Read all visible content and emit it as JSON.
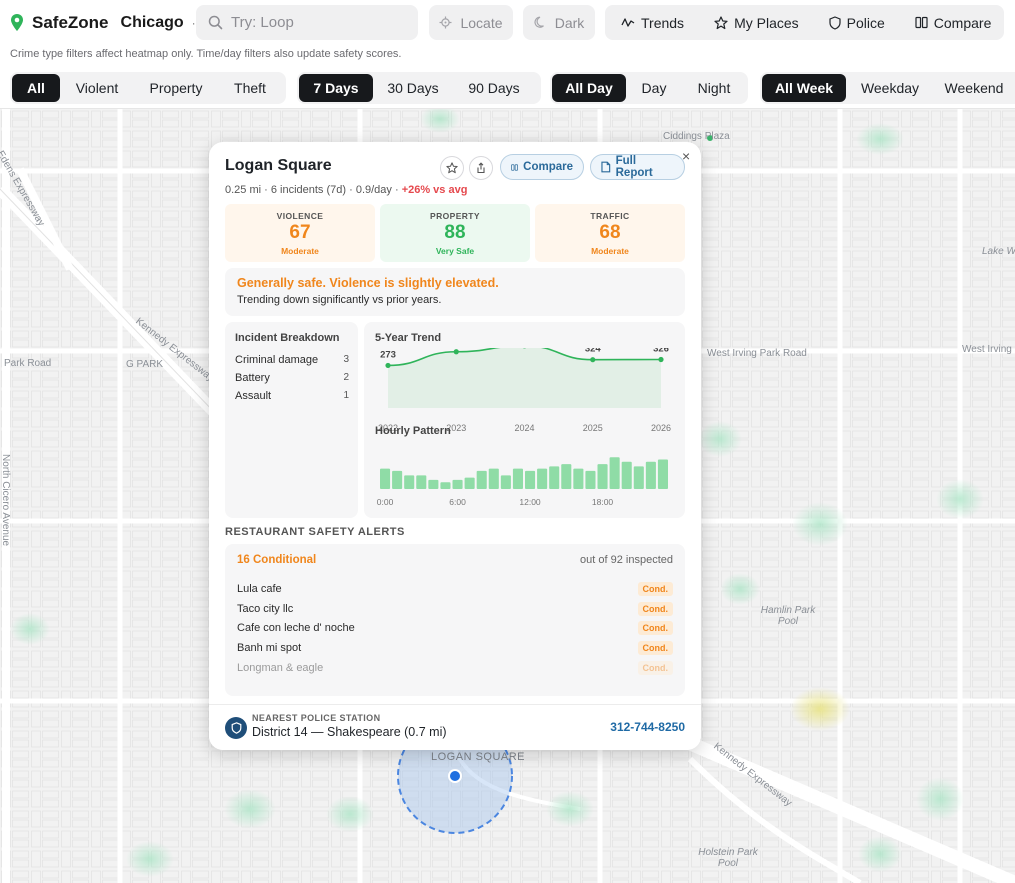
{
  "header": {
    "brand": "SafeZone",
    "city": "Chicago",
    "city_dot": "·",
    "search_placeholder": "Try: Loop",
    "locate_label": "Locate",
    "dark_label": "Dark",
    "nav": [
      {
        "label": "Trends",
        "icon": "trend-line-icon"
      },
      {
        "label": "My Places",
        "icon": "star-icon"
      },
      {
        "label": "Police",
        "icon": "shield-icon"
      },
      {
        "label": "Compare",
        "icon": "columns-icon"
      }
    ],
    "hint": "Crime type filters affect heatmap only. Time/day filters also update safety scores."
  },
  "filters": {
    "crime_types": [
      "All",
      "Violent",
      "Property",
      "Theft"
    ],
    "crime_selected": "All",
    "periods": [
      "7 Days",
      "30 Days",
      "90 Days"
    ],
    "period_selected": "7 Days",
    "times": [
      "All Day",
      "Day",
      "Night"
    ],
    "time_selected": "All Day",
    "days": [
      "All Week",
      "Weekday",
      "Weekend"
    ],
    "day_selected": "All Week"
  },
  "map": {
    "labels": [
      "Ciddings Plaza",
      "Edens Expressway",
      "Kennedy Expressway",
      "Park Road",
      "G PARK",
      "West Irving Park Road",
      "West Irving",
      "Lake W",
      "North Cicero Avenue",
      "Hamlin Park Pool",
      "Holstein Park Pool",
      "LOGAN SQUARE",
      "Kennedy Expressway"
    ]
  },
  "card": {
    "title": "Logan Square",
    "subtitle": "0.25 mi · 6 incidents (7d) · 0.9/day · ",
    "subtitle_delta": "+26% vs avg",
    "compare_label": "Compare",
    "report_label": "Full Report",
    "close_label": "×",
    "scores": [
      {
        "label": "VIOLENCE",
        "value": "67",
        "caption": "Moderate",
        "color": "#f0861c",
        "bg": "#fff6ec"
      },
      {
        "label": "PROPERTY",
        "value": "88",
        "caption": "Very Safe",
        "color": "#2fb45a",
        "bg": "#ecf9f0"
      },
      {
        "label": "TRAFFIC",
        "value": "68",
        "caption": "Moderate",
        "color": "#f0861c",
        "bg": "#fff6ec"
      }
    ],
    "summary_headline": "Generally safe. Violence is slightly elevated.",
    "summary_text": "Trending down significantly vs prior years.",
    "breakdown_title": "Incident Breakdown",
    "breakdown": [
      {
        "name": "Criminal damage",
        "count": "3"
      },
      {
        "name": "Battery",
        "count": "2"
      },
      {
        "name": "Assault",
        "count": "1"
      }
    ],
    "trend_title": "5-Year Trend",
    "hourly_title": "Hourly Pattern",
    "alerts_title": "RESTAURANT SAFETY ALERTS",
    "alerts_count": "16 Conditional",
    "alerts_inspected": "out of 92 inspected",
    "badge_label": "Cond.",
    "restaurants": [
      "Lula cafe",
      "Taco city llc",
      "Cafe con leche d' noche",
      "Banh mi spot",
      "Longman & eagle"
    ],
    "station_label": "NEAREST POLICE STATION",
    "station_name": "District 14 — Shakespeare (0.7 mi)",
    "station_phone": "312-744-8250"
  },
  "colors": {
    "accent_green": "#2fb45a",
    "accent_orange": "#f0861c",
    "alert_red": "#e5484d",
    "link_blue": "#1f6aa5",
    "brand_pin": "#2fb45a"
  },
  "chart_data": [
    {
      "type": "line",
      "title": "5-Year Trend",
      "x": [
        "2022",
        "2023",
        "2024",
        "2025",
        "2026"
      ],
      "values": [
        273,
        395,
        448,
        324,
        326
      ],
      "ylim": [
        0,
        1500
      ],
      "grid": false,
      "color": "#2fb45a"
    },
    {
      "type": "bar",
      "title": "Hourly Pattern",
      "categories": [
        "0:00",
        "1",
        "2",
        "3",
        "4",
        "5",
        "6:00",
        "7",
        "8",
        "9",
        "10",
        "11",
        "12:00",
        "13",
        "14",
        "15",
        "16",
        "17",
        "18:00",
        "19",
        "20",
        "21",
        "22",
        "23"
      ],
      "tick_labels": [
        "0:00",
        "6:00",
        "12:00",
        "18:00"
      ],
      "values": [
        9,
        8,
        6,
        6,
        4,
        3,
        4,
        5,
        8,
        9,
        6,
        9,
        8,
        9,
        10,
        11,
        9,
        8,
        11,
        14,
        12,
        10,
        12,
        13
      ],
      "ylim": [
        0,
        15
      ],
      "grid": false,
      "color": "#8fdca6"
    }
  ]
}
